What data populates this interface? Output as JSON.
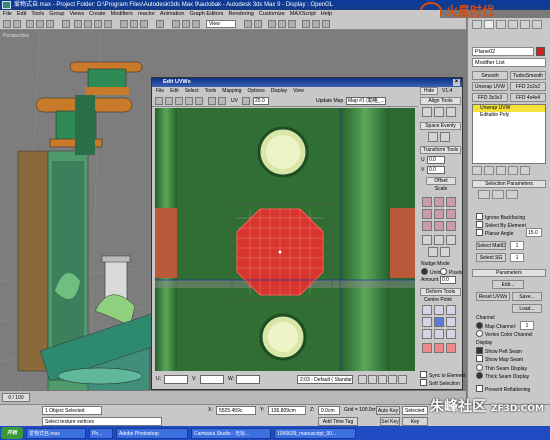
{
  "window": {
    "title": "爱物式自.max - Project Folder: D:\\Program Files\\Autodesk\\3ds Max 9\\autobak  -  Autodesk 3ds Max 9  -  Display : OpenGL"
  },
  "watermark": {
    "text": "火星时代",
    "sub": "www.hxsd.com"
  },
  "menubar": [
    "File",
    "Edit",
    "Tools",
    "Group",
    "Views",
    "Create",
    "Modifiers",
    "reactor",
    "Animation",
    "Graph Editors",
    "Rendering",
    "Customize",
    "MAXScript",
    "Help"
  ],
  "toolbar": {
    "view_value": "View"
  },
  "viewport": {
    "label": "Perspective"
  },
  "command_panel": {
    "object_name": "Plane02",
    "modifier_list": "Modifier List",
    "buttons": [
      "Smooth",
      "TurboSmooth",
      "Unwrap UVW",
      "FFD 2x2x2",
      "FFD 3x3x3",
      "FFD 4x4x4"
    ],
    "stack": [
      "Unwrap UVW",
      "Editable Poly"
    ],
    "selection_params": "Selection Parameters",
    "checks": [
      "Ignore Backfacing",
      "Select By Element",
      "Planar Angle"
    ],
    "planar_angle": "15.0",
    "select_matid": "Select MatID",
    "select_sg": "Select SG",
    "parameters": "Parameters",
    "edit": "Edit...",
    "reset_uvws": "Reset UVWs",
    "save": "Save...",
    "load": "Load...",
    "channel": "Channel",
    "map_channel_label": "Map Channel:",
    "map_channel_value": "1",
    "vertex_color_channel": "Vertex Color Channel",
    "display": "Display",
    "show_pelt_seam": "Show Pelt Seam",
    "show_map_seam": "Show Map Seam",
    "thin_seam": "Thin Seam Display",
    "thick_seam": "Thick Seam Display",
    "prevent_reflattening": "Prevent Reflattening"
  },
  "uvw_dialog": {
    "title": "Edit UVWs",
    "menu": [
      "File",
      "Edit",
      "Select",
      "Tools",
      "Mapping",
      "Options",
      "Display",
      "View"
    ],
    "uv_mode": "UV",
    "field_value": "25.0",
    "update_map": "Update Map",
    "map_value": "Map #1 (勒格_...",
    "hide": "Hide",
    "v_label": "V1.4",
    "align_tools": "Align Tools",
    "space_evenly": "Space Evenly",
    "transform_tools": "Transform Tools",
    "u_value": "0.0",
    "v_value": "0.0",
    "offset": "Offset",
    "scale": "Scale",
    "nudge_mode": "Nudge Mode",
    "units": "Units",
    "pixels": "Pixels",
    "amount_label": "Amount",
    "amount_value": "0.0",
    "deform_tools": "Deform Tools",
    "centre_point": "Centre Point",
    "sync_element": "Sync to Element",
    "soft_selection": "Soft Selection",
    "bottom_u": "U:",
    "bottom_v": "V:",
    "bottom_w": "W:",
    "all_ids": "2:03 - Default ( Standar"
  },
  "timeline": {
    "frame": "0 / 100"
  },
  "status": {
    "selected": "1 Object Selected",
    "prompt": "Select texture vertices",
    "x_label": "X:",
    "x_value": "5525.459c",
    "y_label": "Y:",
    "y_value": "136.809cm",
    "z_label": "Z:",
    "z_value": "0.0cm",
    "grid": "Grid = 100.0cm",
    "add_time_tag": "Add Time Tag",
    "auto_key": "Auto Key",
    "selected_dd": "Selected",
    "set_key": "Set Key",
    "key_filters": "Key Filters..."
  },
  "taskbar": {
    "start": "开始",
    "tasks": [
      "爱物式自.max",
      "Ph...",
      "Adobe Photoshop",
      "Camtasia Studio - 无标...",
      "1096639_manuscript_00..."
    ]
  },
  "corner_watermark": {
    "text": "朱峰社区",
    "sub": "ZF3D.COM"
  }
}
